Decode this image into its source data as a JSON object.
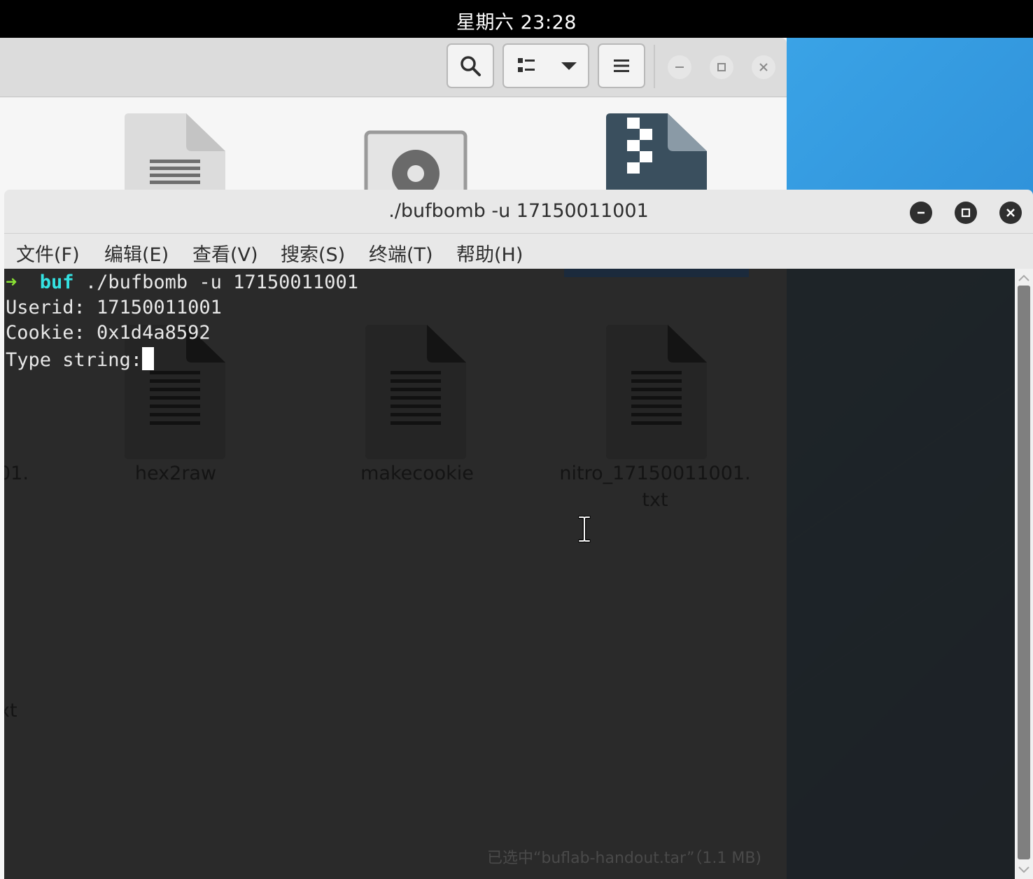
{
  "topbar": {
    "clock": "星期六 23:28"
  },
  "file_manager": {
    "toolbar": {
      "search_icon": "search-icon",
      "view_icon": "list-view-icon",
      "menu_icon": "hamburger-icon"
    },
    "labels": [
      "hex2raw",
      "makecookie",
      "nitro_17150011001.",
      "txt"
    ],
    "partial_labels": [
      "01.",
      "xt"
    ],
    "status": "已选中“buflab-handout.tar”（1.1 MB)"
  },
  "terminal": {
    "title": "./bufbomb -u 17150011001",
    "menu": [
      "文件(F)",
      "编辑(E)",
      "查看(V)",
      "搜索(S)",
      "终端(T)",
      "帮助(H)"
    ],
    "prompt_arrow": "➜",
    "prompt_dir": "buf",
    "command": "./bufbomb -u 17150011001",
    "lines": [
      "Userid: 17150011001",
      "Cookie: 0x1d4a8592",
      "Type string:"
    ]
  },
  "colors": {
    "prompt_arrow": "#8ae234",
    "prompt_dir": "#34e2e2",
    "terminal_bg": "#1d1d1d",
    "desktop": "#2e8fd8"
  }
}
